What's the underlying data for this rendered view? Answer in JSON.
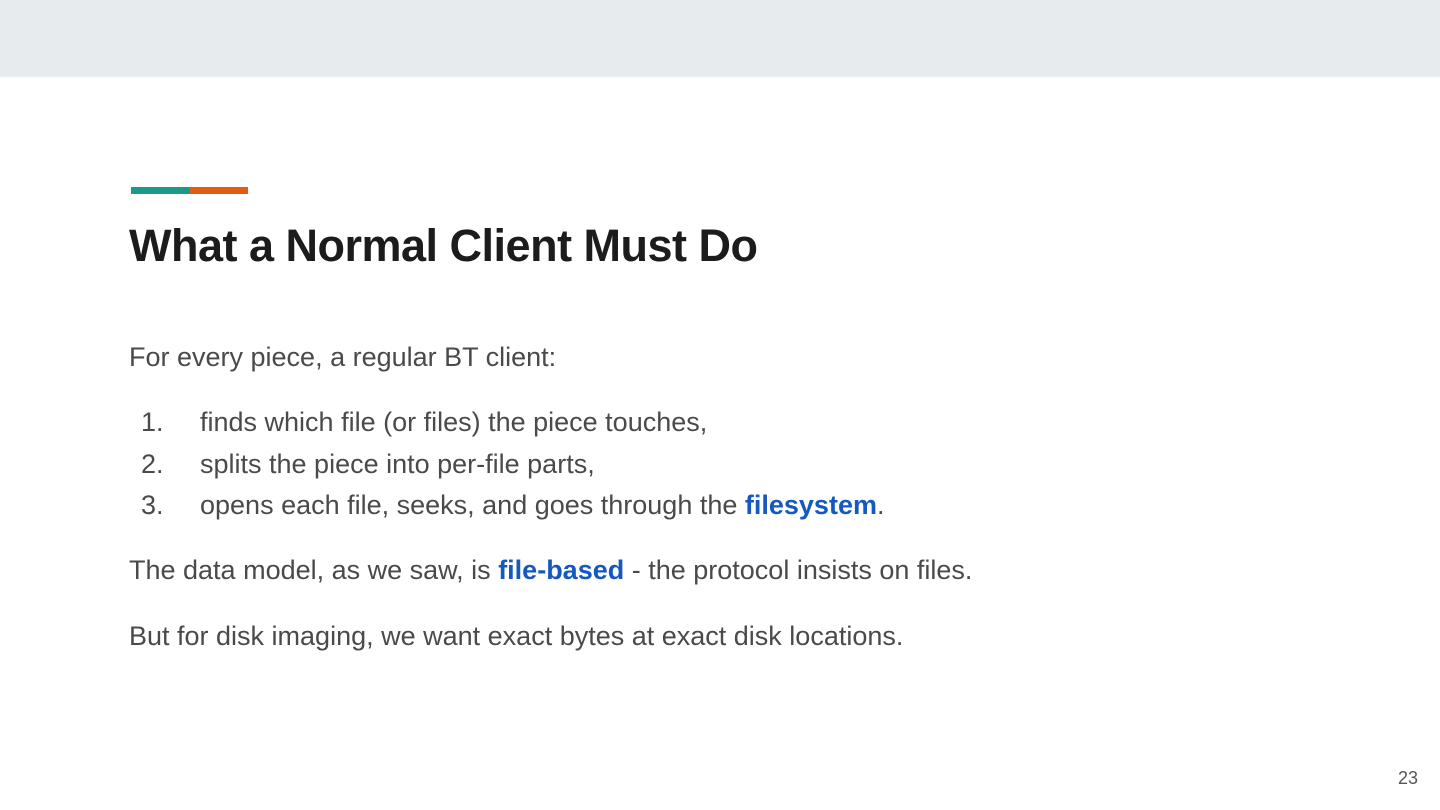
{
  "slide": {
    "title": "What a Normal Client Must Do",
    "intro": "For every piece, a regular BT client:",
    "steps": [
      {
        "number": "1.",
        "text": "finds which file (or files) the piece touches,"
      },
      {
        "number": "2.",
        "text": "splits the piece into per-file parts,"
      },
      {
        "number": "3.",
        "text_before": "opens each file, seeks, and goes through the ",
        "highlight": "filesystem",
        "text_after": "."
      }
    ],
    "para2": {
      "before": "The data model, as we saw, is ",
      "highlight": "file-based",
      "after": " - the protocol insists on files."
    },
    "para3": "But for disk imaging, we want exact bytes at exact disk locations.",
    "page_number": "23"
  },
  "colors": {
    "accent_teal": "#1a9a8a",
    "accent_orange": "#e35c0f",
    "highlight_blue": "#1558c0"
  }
}
